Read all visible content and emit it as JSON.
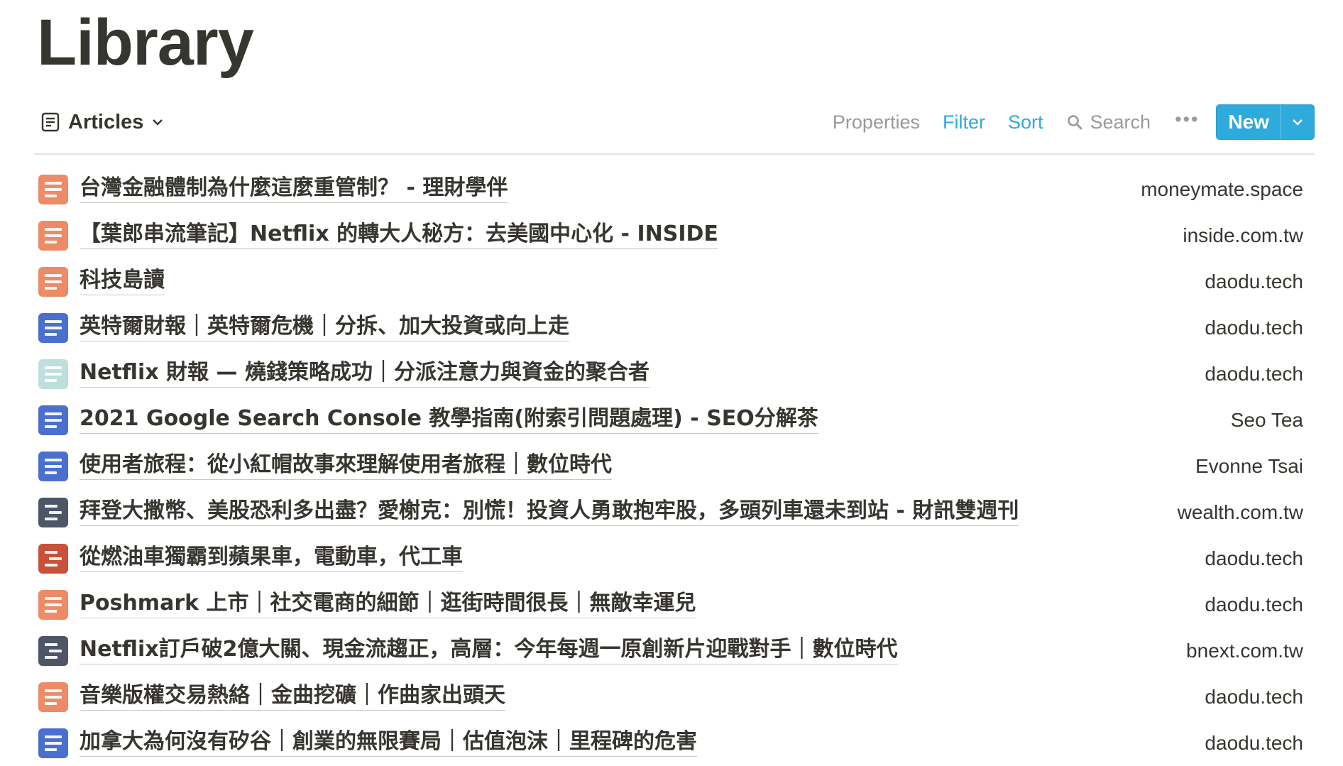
{
  "page": {
    "title": "Library"
  },
  "toolbar": {
    "view_label": "Articles",
    "view_icon": "table-view-icon",
    "properties_label": "Properties",
    "filter_label": "Filter",
    "sort_label": "Sort",
    "search_label": "Search",
    "more_label": "•••",
    "new_label": "New",
    "accent_color": "#2eaadc",
    "muted_color": "#9b9a97"
  },
  "rows": [
    {
      "title": "台灣金融體制為什麼這麼重管制？ - 理財學伴",
      "domain": "moneymate.space",
      "icon_color": "#ec8b66",
      "icon": "document-icon"
    },
    {
      "title": "【葉郎串流筆記】Netflix 的轉大人秘方：去美國中心化 - INSIDE",
      "domain": "inside.com.tw",
      "icon_color": "#ec8b66",
      "icon": "document-icon"
    },
    {
      "title": "科技島讀",
      "domain": "daodu.tech",
      "icon_color": "#ec8b66",
      "icon": "document-icon"
    },
    {
      "title": "英特爾財報｜英特爾危機｜分拆、加大投資或向上走",
      "domain": "daodu.tech",
      "icon_color": "#4a6fcf",
      "icon": "document-icon"
    },
    {
      "title": "Netflix 財報 — 燒錢策略成功｜分派注意力與資金的聚合者",
      "domain": "daodu.tech",
      "icon_color": "#bfdede",
      "icon": "document-icon"
    },
    {
      "title": "2021 Google Search Console 教學指南(附索引問題處理) - SEO分解茶",
      "domain": "Seo Tea",
      "icon_color": "#4a6fcf",
      "icon": "document-icon"
    },
    {
      "title": "使用者旅程：從小紅帽故事來理解使用者旅程｜數位時代",
      "domain": "Evonne Tsai",
      "icon_color": "#4a6fcf",
      "icon": "document-icon"
    },
    {
      "title": "拜登大撒幣、美股恐利多出盡？愛榭克：別慌！投資人勇敢抱牢股，多頭列車還未到站 - 財訊雙週刊",
      "domain": "wealth.com.tw",
      "icon_color": "#4d5566",
      "icon": "document-icon"
    },
    {
      "title": "從燃油車獨霸到蘋果車，電動車，代工車",
      "domain": "daodu.tech",
      "icon_color": "#c9503a",
      "icon": "document-icon"
    },
    {
      "title": "Poshmark 上市｜社交電商的細節｜逛街時間很長｜無敵幸運兒",
      "domain": "daodu.tech",
      "icon_color": "#ec8b66",
      "icon": "document-icon"
    },
    {
      "title": "Netflix訂戶破2億大關、現金流趨正，高層：今年每週一原創新片迎戰對手｜數位時代",
      "domain": "bnext.com.tw",
      "icon_color": "#4d5566",
      "icon": "document-icon"
    },
    {
      "title": "音樂版權交易熱絡｜金曲挖礦｜作曲家出頭天",
      "domain": "daodu.tech",
      "icon_color": "#ec8b66",
      "icon": "document-icon"
    },
    {
      "title": "加拿大為何沒有矽谷｜創業的無限賽局｜估值泡沫｜里程碑的危害",
      "domain": "daodu.tech",
      "icon_color": "#4a6fcf",
      "icon": "document-icon"
    }
  ]
}
